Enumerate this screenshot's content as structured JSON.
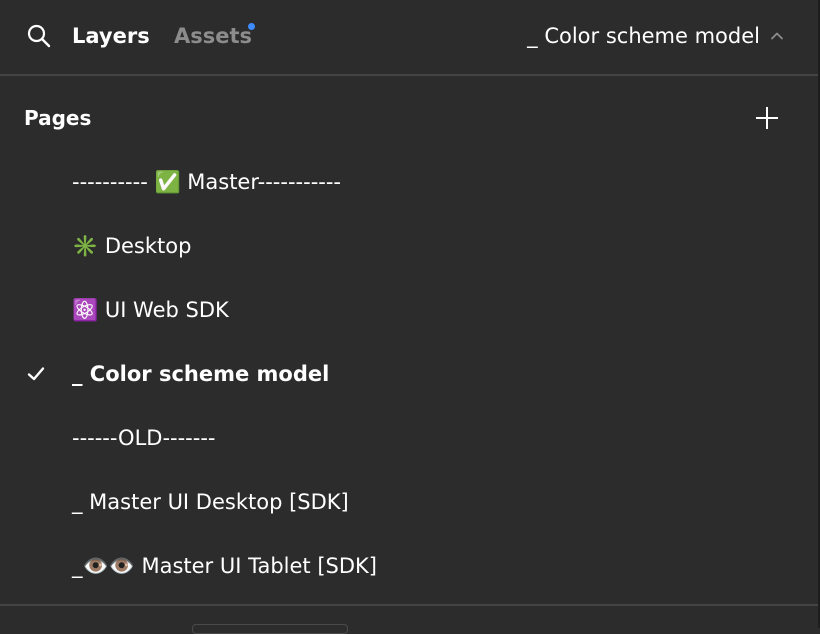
{
  "header": {
    "search_icon": "search-icon",
    "tabs": [
      {
        "label": "Layers",
        "active": true
      },
      {
        "label": "Assets",
        "active": false,
        "has_notification": true
      }
    ],
    "current_page": "_ Color scheme model",
    "chevron_icon": "chevron-up-icon"
  },
  "pages": {
    "title": "Pages",
    "add_icon": "plus-icon",
    "items": [
      {
        "label": "---------- ✅ Master-----------",
        "selected": false
      },
      {
        "label": "✳️ Desktop",
        "selected": false
      },
      {
        "label": "⚛️ UI Web SDK",
        "selected": false
      },
      {
        "label": "_ Color scheme model",
        "selected": true
      },
      {
        "label": "------OLD-------",
        "selected": false
      },
      {
        "label": "_ Master UI Desktop [SDK]",
        "selected": false
      },
      {
        "label": "_👁️👁️ Master UI Tablet [SDK]",
        "selected": false
      }
    ]
  },
  "colors": {
    "background": "#2c2c2c",
    "text_primary": "#ffffff",
    "text_muted": "#8c8c8c",
    "divider": "#444444",
    "notification_dot": "#3d8bfd"
  }
}
